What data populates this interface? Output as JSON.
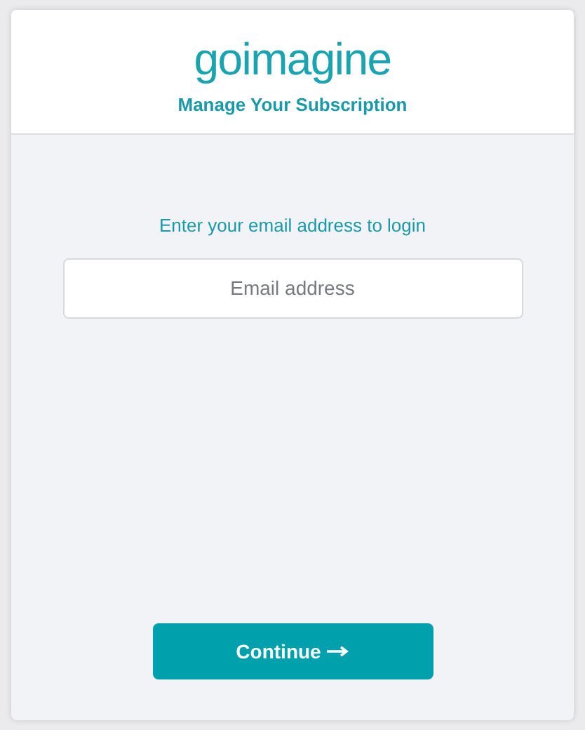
{
  "header": {
    "logo": "goimagine",
    "title": "Manage Your Subscription"
  },
  "login": {
    "prompt": "Enter your email address to login",
    "email_field": {
      "placeholder": "Email address"
    }
  },
  "continue_button": {
    "label": "Continue"
  }
}
